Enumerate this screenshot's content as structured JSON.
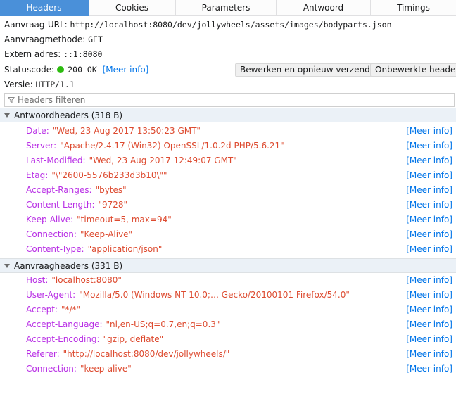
{
  "tabs": [
    {
      "label": "Headers",
      "active": true
    },
    {
      "label": "Cookies",
      "active": false
    },
    {
      "label": "Parameters",
      "active": false
    },
    {
      "label": "Antwoord",
      "active": false
    },
    {
      "label": "Timings",
      "active": false
    }
  ],
  "summary": {
    "url_label": "Aanvraag-URL:",
    "url_value": "http://localhost:8080/dev/jollywheels/assets/images/bodyparts.json",
    "method_label": "Aanvraagmethode:",
    "method_value": "GET",
    "address_label": "Extern adres:",
    "address_value": "::1:8080",
    "status_label": "Statuscode:",
    "status_value": "200 OK",
    "status_color": "#2cbb0f",
    "status_more": "[Meer info]",
    "version_label": "Versie:",
    "version_value": "HTTP/1.1"
  },
  "actions": {
    "edit_resend": "Bewerken en opnieuw verzenden",
    "raw_headers": "Onbewerkte headers"
  },
  "filter": {
    "placeholder": "Headers filteren",
    "value": "",
    "icon": "filter-icon"
  },
  "response_section": {
    "title": "Antwoordheaders (318 B)",
    "headers": [
      {
        "name": "Date",
        "value": "\"Wed, 23 Aug 2017 13:50:23 GMT\"",
        "more": "[Meer info]"
      },
      {
        "name": "Server",
        "value": "\"Apache/2.4.17 (Win32) OpenSSL/1.0.2d PHP/5.6.21\"",
        "more": "[Meer info]"
      },
      {
        "name": "Last-Modified",
        "value": "\"Wed, 23 Aug 2017 12:49:07 GMT\"",
        "more": "[Meer info]"
      },
      {
        "name": "Etag",
        "value": "\"\\\"2600-5576b233d3b10\\\"\"",
        "more": "[Meer info]"
      },
      {
        "name": "Accept-Ranges",
        "value": "\"bytes\"",
        "more": "[Meer info]"
      },
      {
        "name": "Content-Length",
        "value": "\"9728\"",
        "more": "[Meer info]"
      },
      {
        "name": "Keep-Alive",
        "value": "\"timeout=5, max=94\"",
        "more": "[Meer info]"
      },
      {
        "name": "Connection",
        "value": "\"Keep-Alive\"",
        "more": "[Meer info]"
      },
      {
        "name": "Content-Type",
        "value": "\"application/json\"",
        "more": "[Meer info]"
      }
    ]
  },
  "request_section": {
    "title": "Aanvraagheaders (331 B)",
    "headers": [
      {
        "name": "Host",
        "value": "\"localhost:8080\"",
        "more": "[Meer info]"
      },
      {
        "name": "User-Agent",
        "value": "\"Mozilla/5.0 (Windows NT 10.0;… Gecko/20100101 Firefox/54.0\"",
        "more": "[Meer info]"
      },
      {
        "name": "Accept",
        "value": "\"*/*\"",
        "more": "[Meer info]"
      },
      {
        "name": "Accept-Language",
        "value": "\"nl,en-US;q=0.7,en;q=0.3\"",
        "more": "[Meer info]"
      },
      {
        "name": "Accept-Encoding",
        "value": "\"gzip, deflate\"",
        "more": "[Meer info]"
      },
      {
        "name": "Referer",
        "value": "\"http://localhost:8080/dev/jollywheels/\"",
        "more": "[Meer info]"
      },
      {
        "name": "Connection",
        "value": "\"keep-alive\"",
        "more": "[Meer info]"
      }
    ]
  },
  "colors": {
    "accent": "#4a90d9",
    "header_name": "#b82ee5",
    "header_value": "#dd4a2f",
    "link": "#0074e8",
    "section_bg": "#ebf1f7"
  }
}
